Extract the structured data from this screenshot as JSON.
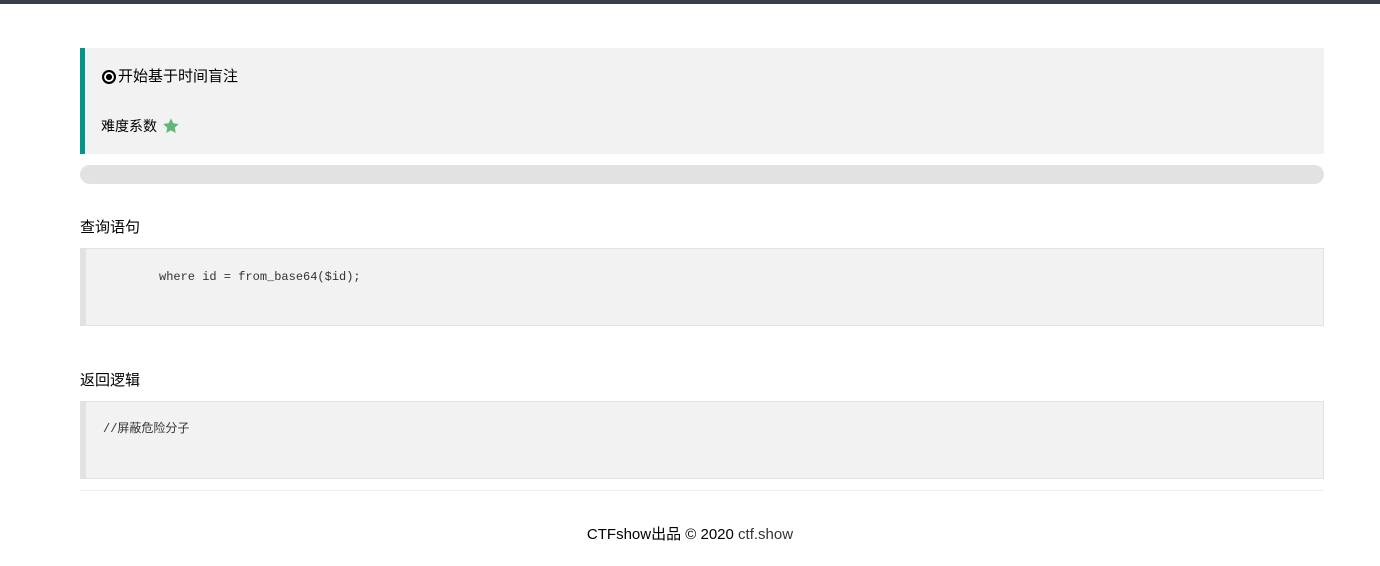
{
  "notice": {
    "title": "开始基于时间盲注",
    "difficulty_label": "难度系数",
    "difficulty_stars": 1,
    "star_color": "#5FB878",
    "accent_color": "#009688"
  },
  "progress": {
    "value": 0
  },
  "query": {
    "label": "查询语句",
    "code": "where id = from_base64($id);"
  },
  "logic": {
    "label": "返回逻辑",
    "code": "//屏蔽危险分子"
  },
  "footer": {
    "text": "CTFshow出品 © 2020",
    "link_text": "ctf.show"
  }
}
